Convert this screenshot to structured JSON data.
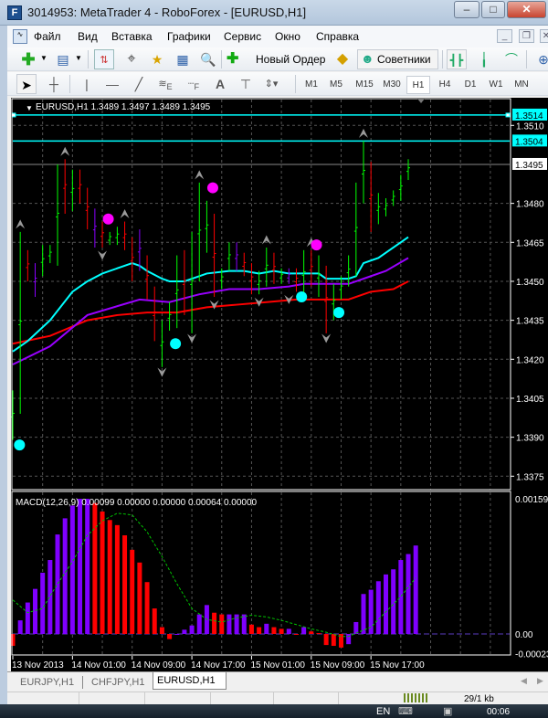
{
  "window": {
    "title": "3014953: MetaTrader 4 - RoboForex - [EURUSD,H1]",
    "app_icon": "metatrader-icon"
  },
  "menu": [
    "Файл",
    "Вид",
    "Вставка",
    "Графики",
    "Сервис",
    "Окно",
    "Справка"
  ],
  "toolbar": {
    "new_order": "Новый Ордер",
    "experts": "Советники"
  },
  "drawing_tools": {
    "text": "A",
    "fibo_e": "E",
    "fibo_f": "F"
  },
  "timeframes": [
    "M1",
    "M5",
    "M15",
    "M30",
    "H1",
    "H4",
    "D1",
    "W1",
    "MN"
  ],
  "active_timeframe": "H1",
  "chart": {
    "header": "EURUSD,H1  1.3489 1.3497 1.3489 1.3495",
    "price_labels": [
      "1.3510",
      "1.3480",
      "1.3465",
      "1.3450",
      "1.3435",
      "1.3420",
      "1.3405",
      "1.3390",
      "1.3375"
    ],
    "hlines": [
      {
        "price": "1.3514",
        "color": "#00ffff"
      },
      {
        "price": "1.3504",
        "color": "#00ffff"
      },
      {
        "price": "1.3495",
        "color": "#ffffff",
        "bid": true
      }
    ],
    "date_labels": [
      "13 Nov 2013",
      "14 Nov 01:00",
      "14 Nov 09:00",
      "14 Nov 17:00",
      "15 Nov 01:00",
      "15 Nov 09:00",
      "15 Nov 17:00"
    ],
    "colors": {
      "up": "#00ff00",
      "down": "#ff0000",
      "neutral": "#8a00ff",
      "ma_fast": "#00ffff",
      "ma_mid": "#9900ff",
      "ma_slow": "#ff0000",
      "sell_dot": "#ff00ff",
      "buy_dot": "#00ffff",
      "macd_up": "#7f00ff",
      "macd_down": "#ff0000",
      "signal": "#00c000"
    }
  },
  "macd": {
    "header": "MACD(12,26,9) 0.00099 0.00000 0.00000 0.00064 0.00000",
    "labels": [
      "0.00159",
      "0.00",
      "-0.00023"
    ]
  },
  "chart_data": {
    "type": "ohlc",
    "bars": [
      [
        1.3408,
        1.3389,
        "up"
      ],
      [
        1.3469,
        1.3399,
        "up"
      ],
      [
        1.3462,
        1.345,
        "down"
      ],
      [
        1.3457,
        1.3444,
        "neutral"
      ],
      [
        1.3464,
        1.3452,
        "up"
      ],
      [
        1.3464,
        1.3457,
        "up"
      ],
      [
        1.3495,
        1.3456,
        "up"
      ],
      [
        1.3497,
        1.3476,
        "down"
      ],
      [
        1.3493,
        1.3477,
        "up"
      ],
      [
        1.3493,
        1.348,
        "down"
      ],
      [
        1.3486,
        1.347,
        "down"
      ],
      [
        1.3478,
        1.3463,
        "neutral"
      ],
      [
        1.3473,
        1.3463,
        "down"
      ],
      [
        1.3469,
        1.3464,
        "up"
      ],
      [
        1.3471,
        1.3464,
        "up"
      ],
      [
        1.3473,
        1.3462,
        "down"
      ],
      [
        1.3467,
        1.345,
        "down"
      ],
      [
        1.347,
        1.3454,
        "neutral"
      ],
      [
        1.346,
        1.3443,
        "down"
      ],
      [
        1.3448,
        1.3427,
        "down"
      ],
      [
        1.3435,
        1.3417,
        "up"
      ],
      [
        1.3442,
        1.3431,
        "up"
      ],
      [
        1.346,
        1.3432,
        "up"
      ],
      [
        1.3462,
        1.3437,
        "down"
      ],
      [
        1.3469,
        1.343,
        "up"
      ],
      [
        1.3488,
        1.345,
        "up"
      ],
      [
        1.3481,
        1.3461,
        "up"
      ],
      [
        1.3476,
        1.3444,
        "down"
      ],
      [
        1.3455,
        1.3447,
        "up"
      ],
      [
        1.3465,
        1.3454,
        "up"
      ],
      [
        1.3465,
        1.3454,
        "neutral"
      ],
      [
        1.3461,
        1.3452,
        "down"
      ],
      [
        1.3457,
        1.3445,
        "down"
      ],
      [
        1.3454,
        1.3445,
        "up"
      ],
      [
        1.3463,
        1.3448,
        "up"
      ],
      [
        1.3461,
        1.3449,
        "down"
      ],
      [
        1.3455,
        1.3449,
        "up"
      ],
      [
        1.3455,
        1.3449,
        "neutral"
      ],
      [
        1.3455,
        1.3446,
        "down"
      ],
      [
        1.3462,
        1.3444,
        "up"
      ],
      [
        1.3462,
        1.3448,
        "down"
      ],
      [
        1.346,
        1.3444,
        "up"
      ],
      [
        1.3456,
        1.343,
        "down"
      ],
      [
        1.3449,
        1.3435,
        "up"
      ],
      [
        1.3452,
        1.3443,
        "up"
      ],
      [
        1.346,
        1.3448,
        "up"
      ],
      [
        1.3488,
        1.3452,
        "up"
      ],
      [
        1.3504,
        1.348,
        "up"
      ],
      [
        1.3496,
        1.3469,
        "down"
      ],
      [
        1.3484,
        1.3472,
        "up"
      ],
      [
        1.3482,
        1.3475,
        "up"
      ],
      [
        1.3485,
        1.3479,
        "up"
      ],
      [
        1.3491,
        1.3481,
        "up"
      ],
      [
        1.3497,
        1.3489,
        "up"
      ]
    ],
    "ma_fast": [
      [
        0,
        1.3423
      ],
      [
        2,
        1.3427
      ],
      [
        5,
        1.3435
      ],
      [
        8,
        1.3446
      ],
      [
        10,
        1.345
      ],
      [
        12,
        1.3453
      ],
      [
        14,
        1.3455
      ],
      [
        16,
        1.3457
      ],
      [
        17,
        1.3456
      ],
      [
        18,
        1.3454
      ],
      [
        20,
        1.3451
      ],
      [
        21,
        1.345
      ],
      [
        23,
        1.345
      ],
      [
        25,
        1.3452
      ],
      [
        26,
        1.3453
      ],
      [
        29,
        1.3454
      ],
      [
        31,
        1.3454
      ],
      [
        33,
        1.3453
      ],
      [
        35,
        1.3454
      ],
      [
        37,
        1.3453
      ],
      [
        41,
        1.3453
      ],
      [
        42,
        1.3451
      ],
      [
        45,
        1.3451
      ],
      [
        46,
        1.3452
      ],
      [
        47,
        1.3457
      ],
      [
        49,
        1.3459
      ],
      [
        51,
        1.3463
      ],
      [
        53,
        1.3467
      ]
    ],
    "ma_mid": [
      [
        0,
        1.3418
      ],
      [
        5,
        1.3425
      ],
      [
        10,
        1.3437
      ],
      [
        17,
        1.3443
      ],
      [
        21,
        1.3442
      ],
      [
        25,
        1.3445
      ],
      [
        29,
        1.3447
      ],
      [
        33,
        1.3447
      ],
      [
        37,
        1.3448
      ],
      [
        39,
        1.3449
      ],
      [
        45,
        1.3449
      ],
      [
        47,
        1.3451
      ],
      [
        50,
        1.3454
      ],
      [
        53,
        1.3459
      ]
    ],
    "ma_slow": [
      [
        0,
        1.3426
      ],
      [
        5,
        1.3429
      ],
      [
        10,
        1.3435
      ],
      [
        14,
        1.3437
      ],
      [
        18,
        1.3438
      ],
      [
        22,
        1.3438
      ],
      [
        26,
        1.344
      ],
      [
        30,
        1.3441
      ],
      [
        34,
        1.3442
      ],
      [
        38,
        1.3443
      ],
      [
        45,
        1.3443
      ],
      [
        48,
        1.3446
      ],
      [
        51,
        1.3447
      ],
      [
        53,
        1.345
      ]
    ],
    "sell_dots": [
      [
        12.8,
        1.3474
      ],
      [
        26.8,
        1.3486
      ],
      [
        40.7,
        1.3464
      ]
    ],
    "buy_dots": [
      [
        0.9,
        1.3387
      ],
      [
        21.8,
        1.3426
      ],
      [
        38.7,
        1.3444
      ],
      [
        43.7,
        1.3438
      ]
    ],
    "up_arrows": [
      [
        1,
        1.3472
      ],
      [
        7,
        1.35
      ],
      [
        15,
        1.3476
      ],
      [
        25,
        1.3491
      ],
      [
        34,
        1.3466
      ],
      [
        40,
        1.3465
      ],
      [
        47,
        1.3507
      ]
    ],
    "down_arrows": [
      [
        12,
        1.346
      ],
      [
        20,
        1.3415
      ],
      [
        24,
        1.3428
      ],
      [
        27,
        1.3441
      ],
      [
        33,
        1.3442
      ],
      [
        37,
        1.3443
      ],
      [
        42,
        1.3428
      ]
    ],
    "ylim": [
      1.337,
      1.352
    ],
    "macd_hist": [
      -0.00014,
      0.00016,
      0.00037,
      0.00053,
      0.00072,
      0.00087,
      0.00117,
      0.00136,
      0.00151,
      0.00159,
      0.00159,
      0.00154,
      0.00144,
      0.00134,
      0.00128,
      0.00116,
      0.00099,
      0.00084,
      0.00061,
      0.0003,
      8e-05,
      -6e-05,
      0,
      5e-05,
      0.0001,
      0.00023,
      0.00034,
      0.00025,
      0.00023,
      0.00023,
      0.00023,
      0.00023,
      0.00011,
      8e-05,
      0.00012,
      8e-05,
      6e-05,
      6e-05,
      0.0,
      8e-05,
      3e-05,
      1e-05,
      -0.00013,
      -0.00014,
      -0.00016,
      -0.00012,
      0.00014,
      0.00047,
      0.00052,
      0.00062,
      0.0007,
      0.00076,
      0.00087,
      0.00094,
      0.00104
    ],
    "macd_signal": [
      [
        0,
        0.0004
      ],
      [
        2,
        0.00025
      ],
      [
        4,
        0.0003
      ],
      [
        6,
        0.00059
      ],
      [
        8,
        0.00085
      ],
      [
        10,
        0.00116
      ],
      [
        12,
        0.00133
      ],
      [
        14,
        0.00142
      ],
      [
        16,
        0.0014
      ],
      [
        18,
        0.0012
      ],
      [
        20,
        0.00091
      ],
      [
        22,
        0.00059
      ],
      [
        24,
        0.0003
      ],
      [
        26,
        0.00017
      ],
      [
        28,
        0.00014
      ],
      [
        30,
        0.00019
      ],
      [
        32,
        0.00022
      ],
      [
        34,
        0.0002
      ],
      [
        36,
        0.00016
      ],
      [
        38,
        0.00011
      ],
      [
        40,
        6e-05
      ],
      [
        42,
        2e-05
      ],
      [
        44,
        -3e-05
      ],
      [
        45,
        -3e-05
      ],
      [
        46,
        1e-05
      ],
      [
        48,
        8e-05
      ],
      [
        50,
        0.00026
      ],
      [
        52,
        0.00044
      ],
      [
        54,
        0.00066
      ]
    ],
    "macd_ylim": [
      -0.00023,
      0.00159
    ]
  },
  "tabs": [
    "EURJPY,H1",
    "CHFJPY,H1",
    "EURUSD,H1"
  ],
  "active_tab": "EURUSD,H1",
  "status": {
    "traffic": "29/1 kb"
  },
  "taskbar": {
    "lang": "EN",
    "time": "00:06"
  }
}
